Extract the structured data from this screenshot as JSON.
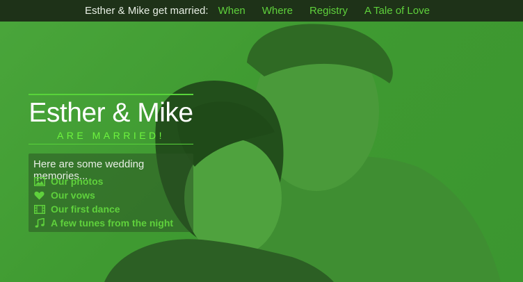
{
  "nav": {
    "title": "Esther & Mike get married:",
    "links": [
      "When",
      "Where",
      "Registry",
      "A Tale of Love"
    ]
  },
  "hero": {
    "names": "Esther & Mike",
    "subtitle": "ARE MARRIED!"
  },
  "memories": {
    "heading": "Here are some wedding memories...",
    "items": [
      {
        "label": "Our photos",
        "icon": "image-icon"
      },
      {
        "label": "Our vows",
        "icon": "heart-icon"
      },
      {
        "label": "Our first dance",
        "icon": "film-icon"
      },
      {
        "label": "A few tunes from the night",
        "icon": "music-icon"
      }
    ]
  },
  "colors": {
    "overlay_green": "#49a43a",
    "nav_bg": "#1e3218",
    "link_green": "#5fd13c",
    "accent_green": "#6ef43f"
  }
}
